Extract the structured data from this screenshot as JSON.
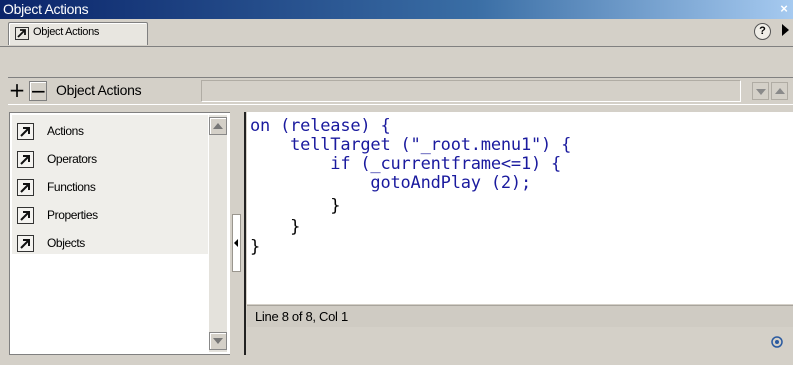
{
  "window": {
    "title": "Object Actions",
    "close_glyph": "×"
  },
  "tab": {
    "label": "Object Actions",
    "icon": "actions-arrow-icon"
  },
  "panel_controls": {
    "help_glyph": "?"
  },
  "toolbar": {
    "add_glyph": "+",
    "remove_glyph": "−",
    "title": "Object Actions"
  },
  "toolbox": {
    "items": [
      {
        "label": "Actions"
      },
      {
        "label": "Operators"
      },
      {
        "label": "Functions"
      },
      {
        "label": "Properties"
      },
      {
        "label": "Objects"
      }
    ]
  },
  "script": {
    "lines": [
      "on (release) {",
      "    tellTarget (\"_root.menu1\") {",
      "        if (_currentframe<=1) {",
      "            gotoAndPlay (2);",
      "        }",
      "    }",
      "}"
    ]
  },
  "status": {
    "text": "Line 8 of 8, Col 1"
  },
  "colors": {
    "title_bar": "#0a246a",
    "chrome": "#d4d0c8",
    "code_keyword": "#1a1a9e"
  }
}
